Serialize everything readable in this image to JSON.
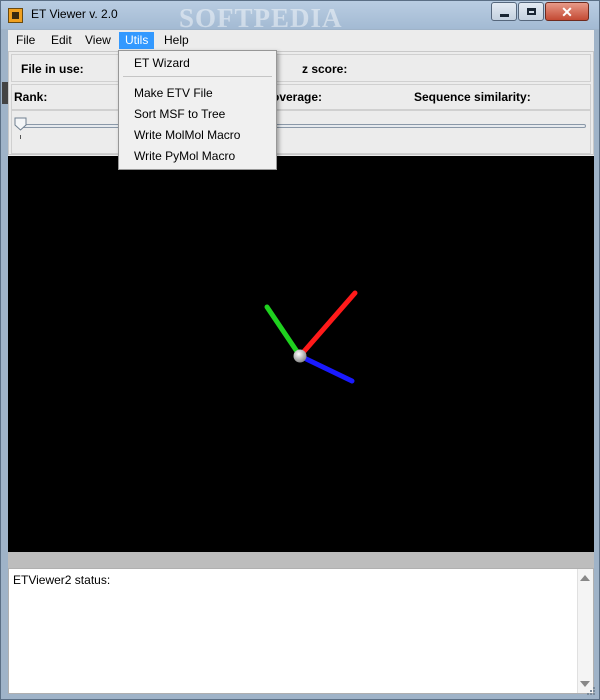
{
  "window": {
    "title": "ET Viewer v. 2.0",
    "watermark": "SOFTPEDIA"
  },
  "menubar": {
    "items": [
      {
        "label": "File"
      },
      {
        "label": "Edit"
      },
      {
        "label": "View"
      },
      {
        "label": "Utils"
      },
      {
        "label": "Help"
      }
    ],
    "active": "Utils"
  },
  "utils_menu": {
    "items": [
      "ET Wizard",
      "Make ETV File",
      "Sort MSF to Tree",
      "Write MolMol Macro",
      "Write PyMol Macro"
    ]
  },
  "info_panel": {
    "file_in_use_label": "File in use:",
    "z_score_label": "z score:",
    "rank_label": "Rank:",
    "coverage_label": "overage:",
    "sequence_similarity_label": "Sequence similarity:"
  },
  "slider": {
    "value": 0
  },
  "viewport": {
    "axes": [
      {
        "name": "x-axis",
        "color": "#ff1a1a"
      },
      {
        "name": "y-axis",
        "color": "#1fd11f"
      },
      {
        "name": "z-axis",
        "color": "#1a1aff"
      }
    ],
    "background": "#000000"
  },
  "status_panel": {
    "label": "ETViewer2 status:"
  },
  "colors": {
    "menu_active": "#3399ff",
    "titlebar": "#a3bad3"
  }
}
